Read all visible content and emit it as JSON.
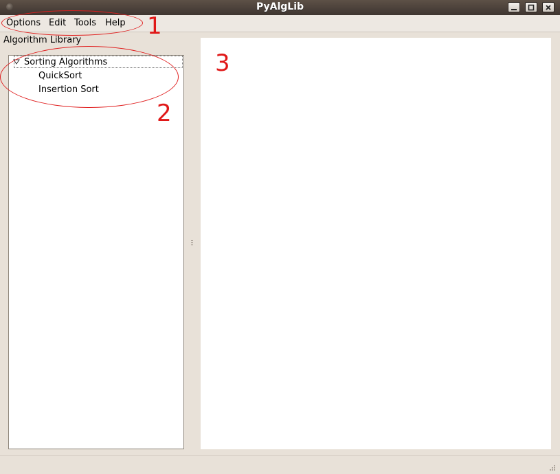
{
  "window": {
    "title": "PyAlgLib"
  },
  "menubar": {
    "items": [
      "Options",
      "Edit",
      "Tools",
      "Help"
    ]
  },
  "library": {
    "label": "Algorithm Library",
    "category": "Sorting Algorithms",
    "items": [
      "QuickSort",
      "Insertion Sort"
    ]
  },
  "annotations": [
    "1",
    "2",
    "3"
  ],
  "colors": {
    "titlebar": "#4a3f37",
    "annotation": "#e02020",
    "window_bg": "#e8e1d8"
  },
  "icons": {
    "collapse": "triangle-down-icon",
    "minimize": "minimize-icon",
    "maximize": "maximize-icon",
    "close": "close-icon"
  }
}
